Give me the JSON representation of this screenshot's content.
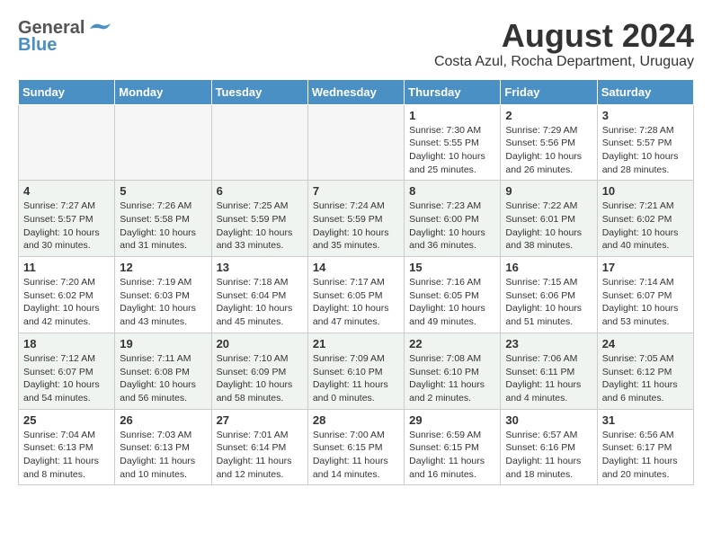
{
  "header": {
    "logo_general": "General",
    "logo_blue": "Blue",
    "month_title": "August 2024",
    "location": "Costa Azul, Rocha Department, Uruguay"
  },
  "days_of_week": [
    "Sunday",
    "Monday",
    "Tuesday",
    "Wednesday",
    "Thursday",
    "Friday",
    "Saturday"
  ],
  "weeks": [
    [
      {
        "day": "",
        "empty": true
      },
      {
        "day": "",
        "empty": true
      },
      {
        "day": "",
        "empty": true
      },
      {
        "day": "",
        "empty": true
      },
      {
        "day": "1",
        "sunrise": "7:30 AM",
        "sunset": "5:55 PM",
        "daylight": "10 hours and 25 minutes."
      },
      {
        "day": "2",
        "sunrise": "7:29 AM",
        "sunset": "5:56 PM",
        "daylight": "10 hours and 26 minutes."
      },
      {
        "day": "3",
        "sunrise": "7:28 AM",
        "sunset": "5:57 PM",
        "daylight": "10 hours and 28 minutes."
      }
    ],
    [
      {
        "day": "4",
        "sunrise": "7:27 AM",
        "sunset": "5:57 PM",
        "daylight": "10 hours and 30 minutes."
      },
      {
        "day": "5",
        "sunrise": "7:26 AM",
        "sunset": "5:58 PM",
        "daylight": "10 hours and 31 minutes."
      },
      {
        "day": "6",
        "sunrise": "7:25 AM",
        "sunset": "5:59 PM",
        "daylight": "10 hours and 33 minutes."
      },
      {
        "day": "7",
        "sunrise": "7:24 AM",
        "sunset": "5:59 PM",
        "daylight": "10 hours and 35 minutes."
      },
      {
        "day": "8",
        "sunrise": "7:23 AM",
        "sunset": "6:00 PM",
        "daylight": "10 hours and 36 minutes."
      },
      {
        "day": "9",
        "sunrise": "7:22 AM",
        "sunset": "6:01 PM",
        "daylight": "10 hours and 38 minutes."
      },
      {
        "day": "10",
        "sunrise": "7:21 AM",
        "sunset": "6:02 PM",
        "daylight": "10 hours and 40 minutes."
      }
    ],
    [
      {
        "day": "11",
        "sunrise": "7:20 AM",
        "sunset": "6:02 PM",
        "daylight": "10 hours and 42 minutes."
      },
      {
        "day": "12",
        "sunrise": "7:19 AM",
        "sunset": "6:03 PM",
        "daylight": "10 hours and 43 minutes."
      },
      {
        "day": "13",
        "sunrise": "7:18 AM",
        "sunset": "6:04 PM",
        "daylight": "10 hours and 45 minutes."
      },
      {
        "day": "14",
        "sunrise": "7:17 AM",
        "sunset": "6:05 PM",
        "daylight": "10 hours and 47 minutes."
      },
      {
        "day": "15",
        "sunrise": "7:16 AM",
        "sunset": "6:05 PM",
        "daylight": "10 hours and 49 minutes."
      },
      {
        "day": "16",
        "sunrise": "7:15 AM",
        "sunset": "6:06 PM",
        "daylight": "10 hours and 51 minutes."
      },
      {
        "day": "17",
        "sunrise": "7:14 AM",
        "sunset": "6:07 PM",
        "daylight": "10 hours and 53 minutes."
      }
    ],
    [
      {
        "day": "18",
        "sunrise": "7:12 AM",
        "sunset": "6:07 PM",
        "daylight": "10 hours and 54 minutes."
      },
      {
        "day": "19",
        "sunrise": "7:11 AM",
        "sunset": "6:08 PM",
        "daylight": "10 hours and 56 minutes."
      },
      {
        "day": "20",
        "sunrise": "7:10 AM",
        "sunset": "6:09 PM",
        "daylight": "10 hours and 58 minutes."
      },
      {
        "day": "21",
        "sunrise": "7:09 AM",
        "sunset": "6:10 PM",
        "daylight": "11 hours and 0 minutes."
      },
      {
        "day": "22",
        "sunrise": "7:08 AM",
        "sunset": "6:10 PM",
        "daylight": "11 hours and 2 minutes."
      },
      {
        "day": "23",
        "sunrise": "7:06 AM",
        "sunset": "6:11 PM",
        "daylight": "11 hours and 4 minutes."
      },
      {
        "day": "24",
        "sunrise": "7:05 AM",
        "sunset": "6:12 PM",
        "daylight": "11 hours and 6 minutes."
      }
    ],
    [
      {
        "day": "25",
        "sunrise": "7:04 AM",
        "sunset": "6:13 PM",
        "daylight": "11 hours and 8 minutes."
      },
      {
        "day": "26",
        "sunrise": "7:03 AM",
        "sunset": "6:13 PM",
        "daylight": "11 hours and 10 minutes."
      },
      {
        "day": "27",
        "sunrise": "7:01 AM",
        "sunset": "6:14 PM",
        "daylight": "11 hours and 12 minutes."
      },
      {
        "day": "28",
        "sunrise": "7:00 AM",
        "sunset": "6:15 PM",
        "daylight": "11 hours and 14 minutes."
      },
      {
        "day": "29",
        "sunrise": "6:59 AM",
        "sunset": "6:15 PM",
        "daylight": "11 hours and 16 minutes."
      },
      {
        "day": "30",
        "sunrise": "6:57 AM",
        "sunset": "6:16 PM",
        "daylight": "11 hours and 18 minutes."
      },
      {
        "day": "31",
        "sunrise": "6:56 AM",
        "sunset": "6:17 PM",
        "daylight": "11 hours and 20 minutes."
      }
    ]
  ],
  "labels": {
    "sunrise": "Sunrise:",
    "sunset": "Sunset:",
    "daylight": "Daylight:"
  }
}
